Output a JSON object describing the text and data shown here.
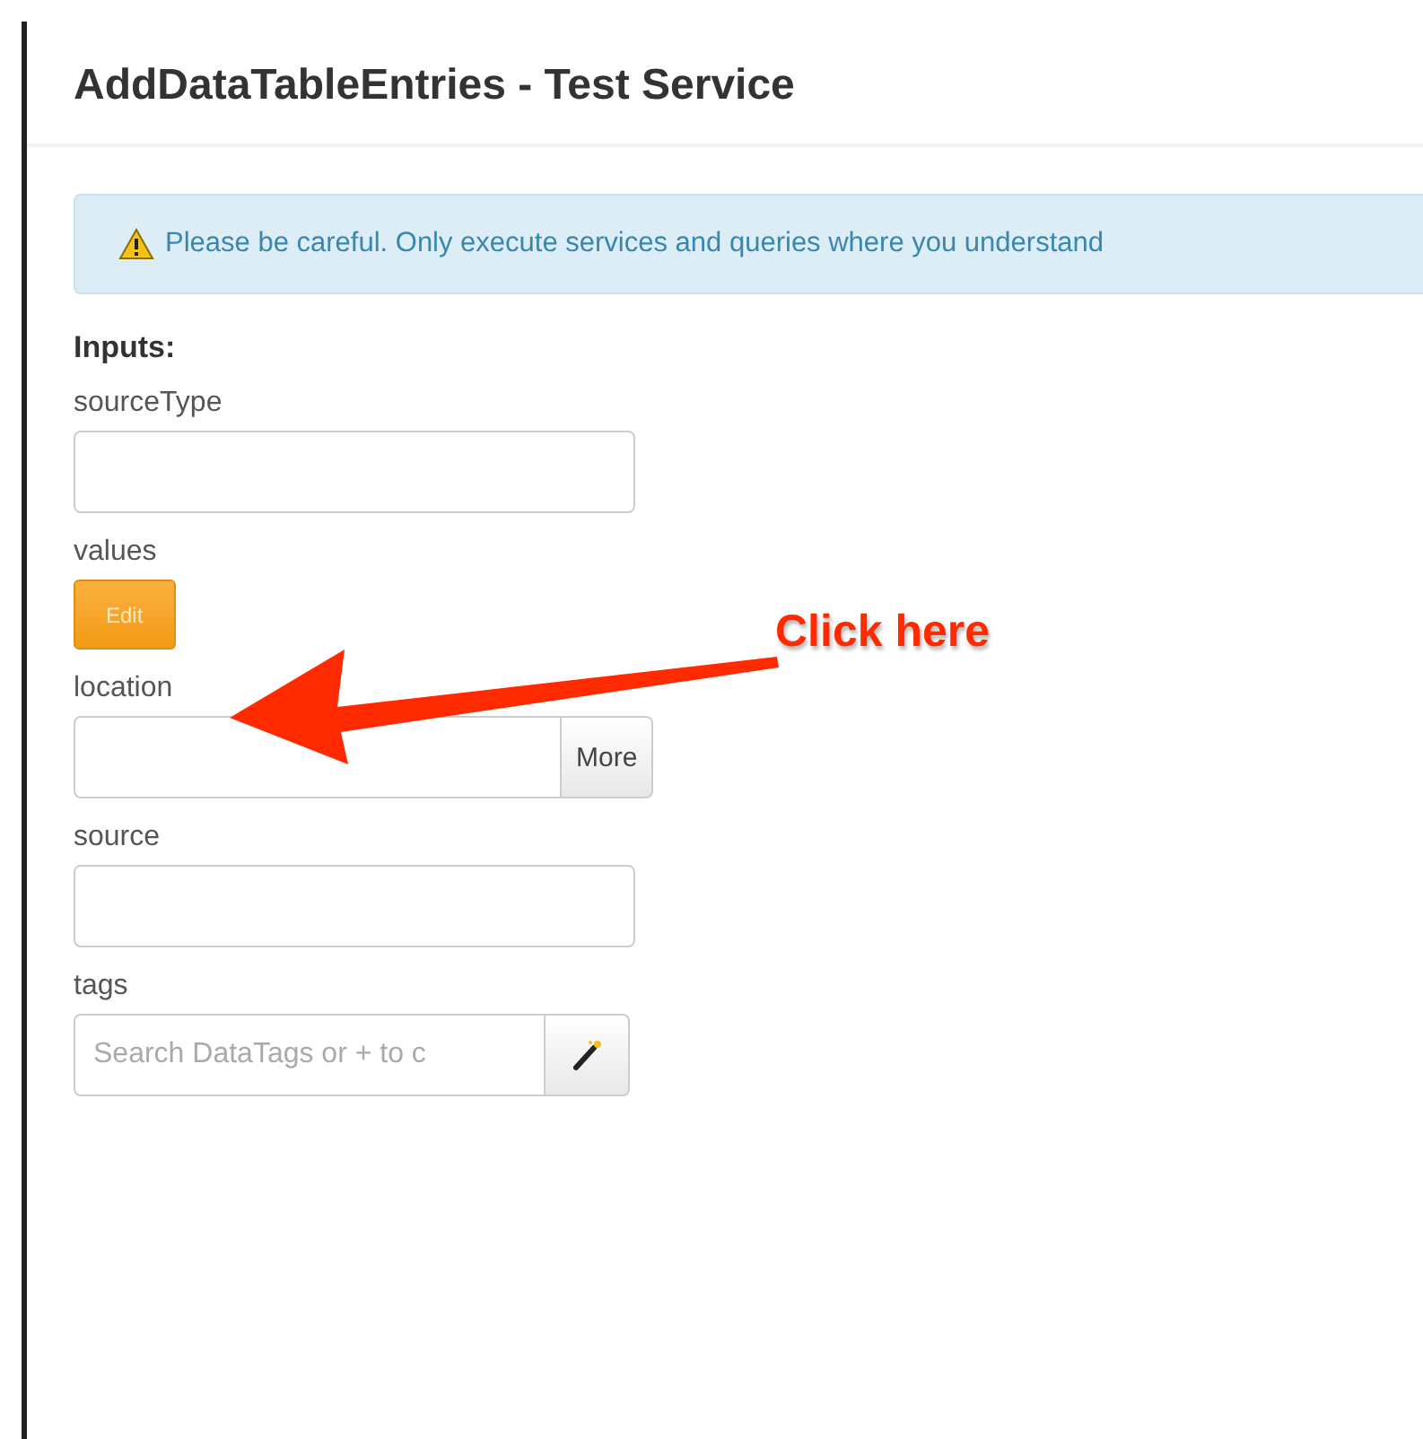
{
  "dialog": {
    "title": "AddDataTableEntries - Test Service"
  },
  "alert": {
    "text": "Please be careful. Only execute services and queries where you understand"
  },
  "inputs_heading": "Inputs:",
  "inputs": [
    {
      "kind": "text",
      "label": "sourceType"
    },
    {
      "kind": "button",
      "label": "values",
      "button": "Edit"
    },
    {
      "kind": "text_more",
      "label": "location",
      "button": "More"
    },
    {
      "kind": "text",
      "label": "source"
    },
    {
      "kind": "tags",
      "label": "tags",
      "placeholder": "Search DataTags or + to c"
    }
  ],
  "annotation": {
    "text": "Click here"
  }
}
